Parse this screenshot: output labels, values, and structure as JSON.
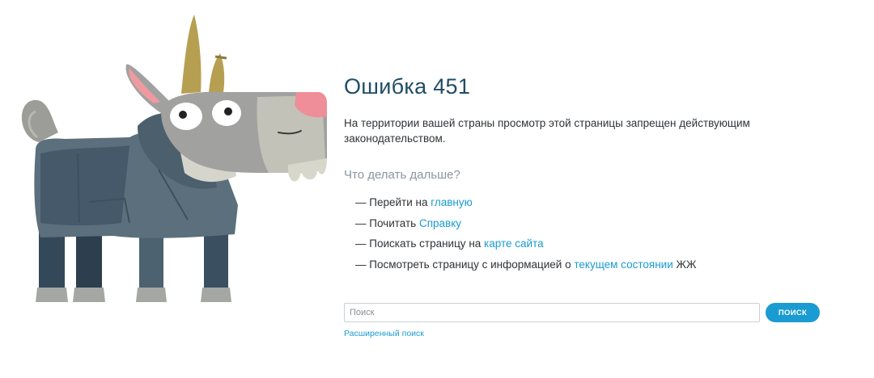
{
  "error": {
    "title": "Ошибка 451",
    "description": "На территории вашей страны просмотр этой страницы запрещен действующим законодательством."
  },
  "next_steps": {
    "heading": "Что делать дальше?",
    "items": [
      {
        "prefix": "— Перейти на ",
        "link": "главную",
        "suffix": ""
      },
      {
        "prefix": "— Почитать ",
        "link": "Справку",
        "suffix": ""
      },
      {
        "prefix": "— Поискать страницу на ",
        "link": "карте сайта",
        "suffix": ""
      },
      {
        "prefix": "— Посмотреть страницу с информацией о ",
        "link": "текущем состоянии",
        "suffix": " ЖЖ"
      }
    ]
  },
  "search": {
    "placeholder": "Поиск",
    "value": "",
    "button_label": "ПОИСК",
    "advanced_link": "Расширенный поиск"
  },
  "mascot": {
    "icon": "goat-mascot-illustration"
  },
  "colors": {
    "title": "#1f4d66",
    "link": "#1a9bd1",
    "muted_heading": "#8a96a0",
    "body_text": "#2f3337"
  }
}
